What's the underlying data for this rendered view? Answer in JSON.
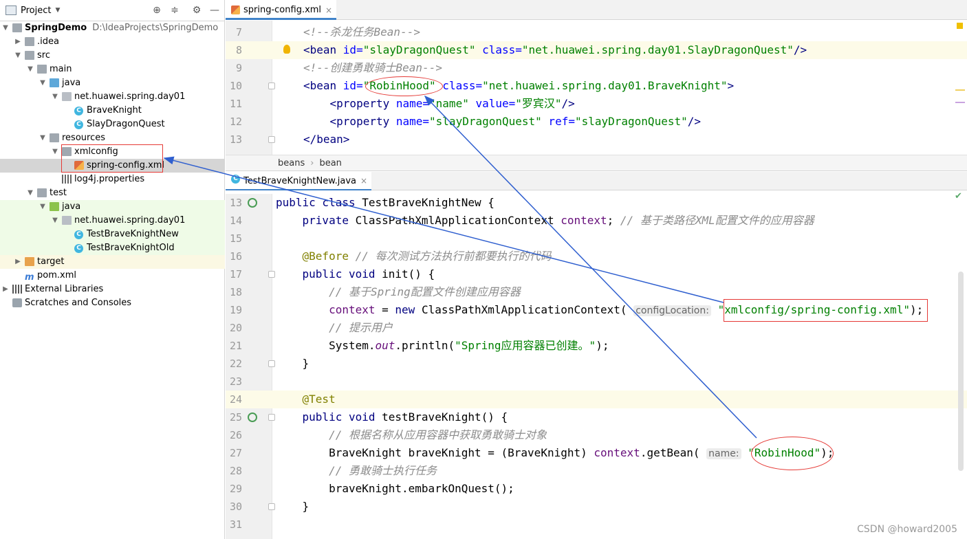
{
  "project_panel": {
    "title": "Project",
    "tree": [
      {
        "label": "SpringDemo",
        "extra": "D:\\IdeaProjects\\SpringDemo",
        "depth": 0,
        "icon": "module-folder-icon",
        "expanded": true
      },
      {
        "label": ".idea",
        "depth": 1,
        "icon": "folder-icon",
        "expanded": false
      },
      {
        "label": "src",
        "depth": 1,
        "icon": "folder-icon",
        "expanded": true
      },
      {
        "label": "main",
        "depth": 2,
        "icon": "folder-icon",
        "expanded": true
      },
      {
        "label": "java",
        "depth": 3,
        "icon": "source-folder-icon",
        "expanded": true
      },
      {
        "label": "net.huawei.spring.day01",
        "depth": 4,
        "icon": "package-icon",
        "expanded": true
      },
      {
        "label": "BraveKnight",
        "depth": 5,
        "icon": "class-icon"
      },
      {
        "label": "SlayDragonQuest",
        "depth": 5,
        "icon": "class-icon"
      },
      {
        "label": "resources",
        "depth": 3,
        "icon": "resources-folder-icon",
        "expanded": true
      },
      {
        "label": "xmlconfig",
        "depth": 4,
        "icon": "folder-icon",
        "expanded": true
      },
      {
        "label": "spring-config.xml",
        "depth": 5,
        "icon": "spring-xml-icon",
        "selected": true
      },
      {
        "label": "log4j.properties",
        "depth": 4,
        "icon": "properties-file-icon"
      },
      {
        "label": "test",
        "depth": 2,
        "icon": "folder-icon",
        "expanded": true
      },
      {
        "label": "java",
        "depth": 3,
        "icon": "test-folder-icon",
        "expanded": true
      },
      {
        "label": "net.huawei.spring.day01",
        "depth": 4,
        "icon": "package-icon",
        "expanded": true
      },
      {
        "label": "TestBraveKnightNew",
        "depth": 5,
        "icon": "test-class-icon"
      },
      {
        "label": "TestBraveKnightOld",
        "depth": 5,
        "icon": "test-class-icon"
      },
      {
        "label": "target",
        "depth": 1,
        "icon": "excluded-folder-icon",
        "expanded": false
      },
      {
        "label": "pom.xml",
        "depth": 1,
        "icon": "maven-icon"
      },
      {
        "label": "External Libraries",
        "depth": 0,
        "icon": "libraries-icon",
        "expanded": false
      },
      {
        "label": "Scratches and Consoles",
        "depth": 0,
        "icon": "scratches-icon"
      }
    ]
  },
  "top_editor": {
    "tab": "spring-config.xml",
    "breadcrumb": [
      "beans",
      "bean"
    ],
    "lines": [
      {
        "n": "7",
        "parts": [
          [
            "cmt",
            "<!--杀龙任务Bean-->"
          ]
        ]
      },
      {
        "n": "8",
        "parts": [
          [
            "tag",
            "<bean "
          ],
          [
            "attr",
            "id="
          ],
          [
            "str",
            "\"slayDragonQuest\""
          ],
          [
            "attr",
            " class="
          ],
          [
            "str",
            "\"net.huawei.spring.day01.SlayDragonQuest\""
          ],
          [
            "tag",
            "/>"
          ]
        ]
      },
      {
        "n": "9",
        "parts": [
          [
            "cmt",
            "<!--创建勇敢骑士Bean-->"
          ]
        ]
      },
      {
        "n": "10",
        "parts": [
          [
            "tag",
            "<bean "
          ],
          [
            "attr",
            "id="
          ],
          [
            "str",
            "\"RobinHood\""
          ],
          [
            "attr",
            " class="
          ],
          [
            "str",
            "\"net.huawei.spring.day01.BraveKnight\""
          ],
          [
            "tag",
            ">"
          ]
        ]
      },
      {
        "n": "11",
        "parts": [
          [
            "tag",
            "    <property "
          ],
          [
            "attr",
            "name="
          ],
          [
            "str",
            "\"name\""
          ],
          [
            "attr",
            " value="
          ],
          [
            "str",
            "\"罗宾汉\""
          ],
          [
            "tag",
            "/>"
          ]
        ]
      },
      {
        "n": "12",
        "parts": [
          [
            "tag",
            "    <property "
          ],
          [
            "attr",
            "name="
          ],
          [
            "str",
            "\"slayDragonQuest\""
          ],
          [
            "attr",
            " ref="
          ],
          [
            "str",
            "\"slayDragonQuest\""
          ],
          [
            "tag",
            "/>"
          ]
        ]
      },
      {
        "n": "13",
        "parts": [
          [
            "tag",
            "</bean>"
          ]
        ]
      }
    ]
  },
  "bottom_editor": {
    "tab": "TestBraveKnightNew.java",
    "lines": [
      {
        "n": "13",
        "parts": [
          [
            "kw",
            "public class "
          ],
          [
            "",
            "TestBraveKnightNew {"
          ]
        ]
      },
      {
        "n": "14",
        "parts": [
          [
            "kw",
            "    private "
          ],
          [
            "",
            "ClassPathXmlApplicationContext "
          ],
          [
            "fld",
            "context"
          ],
          [
            "",
            "; "
          ],
          [
            "cmt",
            "// 基于类路径XML配置文件的应用容器"
          ]
        ]
      },
      {
        "n": "15",
        "parts": []
      },
      {
        "n": "16",
        "parts": [
          [
            "ann",
            "    @Before "
          ],
          [
            "cmt",
            "// 每次测试方法执行前都要执行的代码"
          ]
        ]
      },
      {
        "n": "17",
        "parts": [
          [
            "kw",
            "    public void "
          ],
          [
            "",
            "init() {"
          ]
        ]
      },
      {
        "n": "18",
        "parts": [
          [
            "cmt",
            "        // 基于Spring配置文件创建应用容器"
          ]
        ]
      },
      {
        "n": "19",
        "parts": [
          [
            "fld",
            "        context"
          ],
          [
            "",
            " = "
          ],
          [
            "kw",
            "new "
          ],
          [
            "",
            "ClassPathXmlApplicationContext( "
          ],
          [
            "hint",
            "configLocation:"
          ],
          [
            "str",
            " \"xmlconfig/spring-config.xml\""
          ],
          [
            "",
            ");"
          ]
        ]
      },
      {
        "n": "20",
        "parts": [
          [
            "cmt",
            "        // 提示用户"
          ]
        ]
      },
      {
        "n": "21",
        "parts": [
          [
            "",
            "        System."
          ],
          [
            "ital",
            "out"
          ],
          [
            "",
            ".println("
          ],
          [
            "str",
            "\"Spring应用容器已创建。\""
          ],
          [
            "",
            ");"
          ]
        ]
      },
      {
        "n": "22",
        "parts": [
          [
            "",
            "    }"
          ]
        ]
      },
      {
        "n": "23",
        "parts": []
      },
      {
        "n": "24",
        "parts": [
          [
            "ann",
            "    @Test"
          ]
        ]
      },
      {
        "n": "25",
        "parts": [
          [
            "kw",
            "    public void "
          ],
          [
            "",
            "testBraveKnight() {"
          ]
        ]
      },
      {
        "n": "26",
        "parts": [
          [
            "cmt",
            "        // 根据名称从应用容器中获取勇敢骑士对象"
          ]
        ]
      },
      {
        "n": "27",
        "parts": [
          [
            "",
            "        BraveKnight braveKnight = (BraveKnight) "
          ],
          [
            "fld",
            "context"
          ],
          [
            "",
            ".getBean( "
          ],
          [
            "hint",
            "name:"
          ],
          [
            "str",
            " \"RobinHood\""
          ],
          [
            "",
            ");"
          ]
        ]
      },
      {
        "n": "28",
        "parts": [
          [
            "cmt",
            "        // 勇敢骑士执行任务"
          ]
        ]
      },
      {
        "n": "29",
        "parts": [
          [
            "",
            "        braveKnight.embarkOnQuest();"
          ]
        ]
      },
      {
        "n": "30",
        "parts": [
          [
            "",
            "    }"
          ]
        ]
      },
      {
        "n": "31",
        "parts": []
      }
    ]
  },
  "watermark": "CSDN @howard2005"
}
